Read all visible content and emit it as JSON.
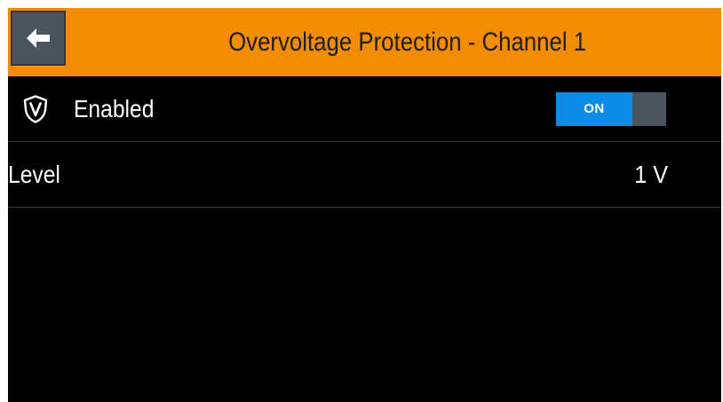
{
  "header": {
    "back_icon": "arrow-left-icon",
    "title": "Overvoltage Protection - Channel 1",
    "background_color": "#f28c00"
  },
  "rows": {
    "enabled": {
      "icon": "shield-v-icon",
      "label": "Enabled",
      "toggle_label": "ON",
      "toggle_state": true,
      "toggle_color": "#0a8ce8"
    },
    "level": {
      "label": "Level",
      "value": "1 V"
    }
  }
}
